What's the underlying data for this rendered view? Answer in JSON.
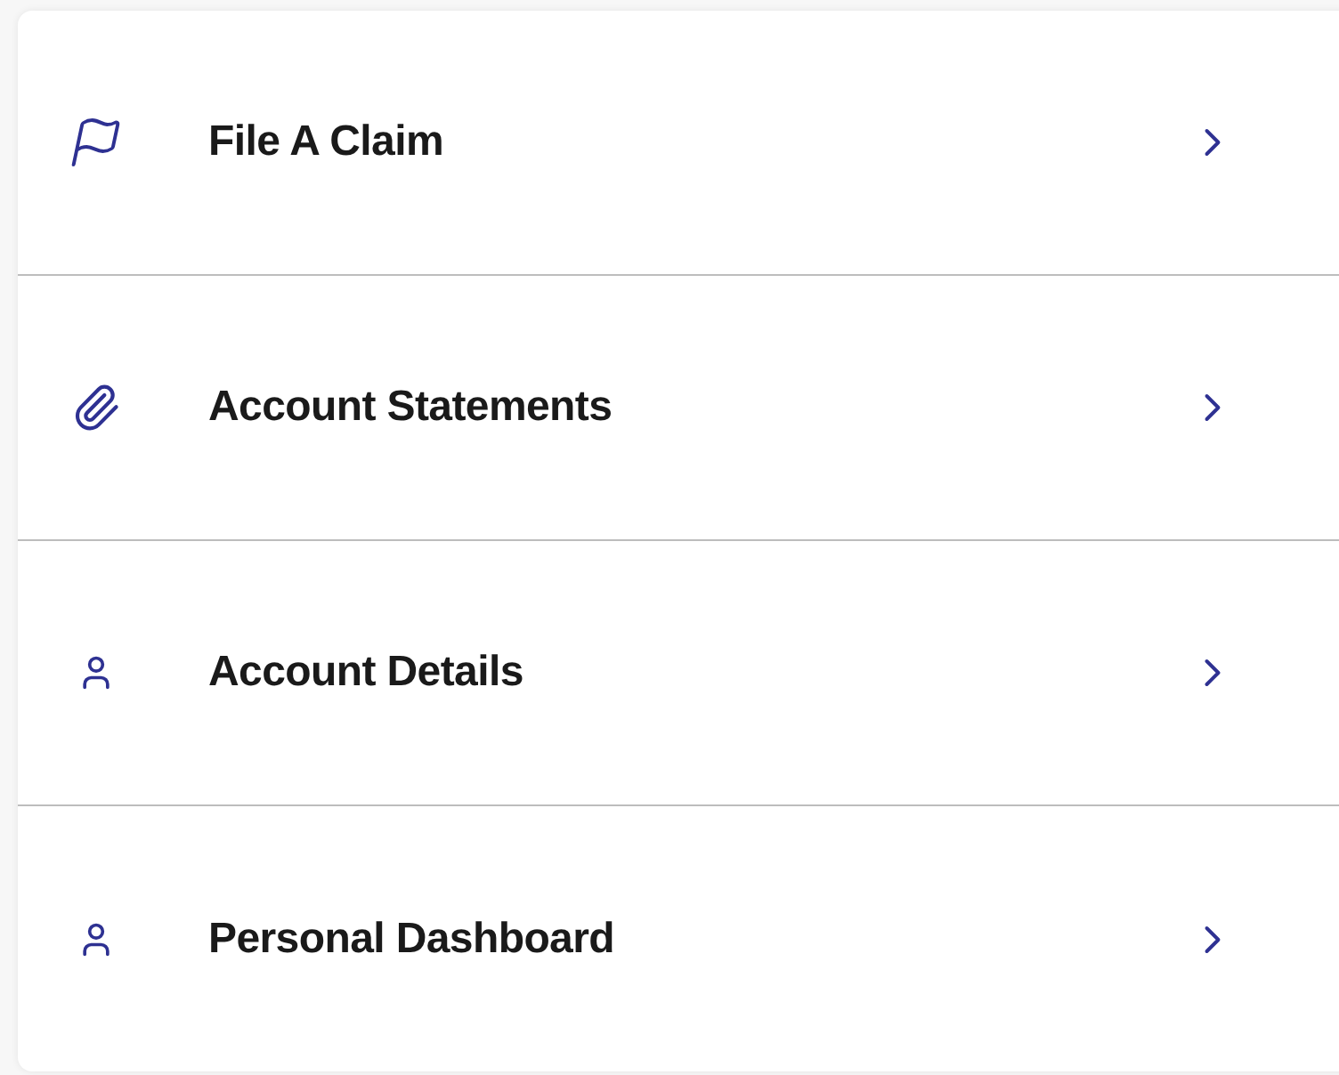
{
  "menu": {
    "items": [
      {
        "kind": "flag",
        "label": "File A Claim"
      },
      {
        "kind": "clip",
        "label": "Account Statements"
      },
      {
        "kind": "person",
        "label": "Account Details"
      },
      {
        "kind": "person",
        "label": "Personal Dashboard"
      }
    ]
  }
}
